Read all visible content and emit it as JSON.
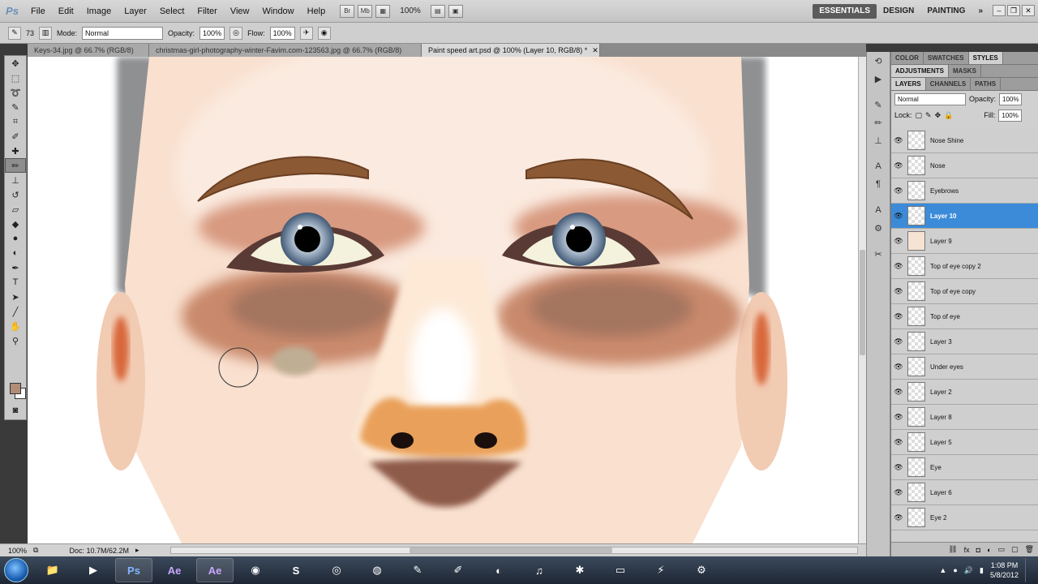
{
  "menubar": {
    "logo": "Ps",
    "items": [
      "File",
      "Edit",
      "Image",
      "Layer",
      "Select",
      "Filter",
      "View",
      "Window",
      "Help"
    ],
    "zoom": "100%",
    "bridge_btn": "Br",
    "minibridge_btn": "Mb",
    "workspaces": [
      "ESSENTIALS",
      "DESIGN",
      "PAINTING"
    ],
    "more": "»"
  },
  "options": {
    "brush_size": "73",
    "mode_label": "Mode:",
    "mode_value": "Normal",
    "opacity_label": "Opacity:",
    "opacity_value": "100%",
    "flow_label": "Flow:",
    "flow_value": "100%"
  },
  "doc_tabs": [
    {
      "label": "Keys-34.jpg @ 66.7% (RGB/8)"
    },
    {
      "label": "christmas-girl-photography-winter-Favim.com-123563.jpg @ 66.7% (RGB/8)"
    },
    {
      "label": "Paint speed art.psd @ 100% (Layer 10, RGB/8) *"
    }
  ],
  "status": {
    "zoom": "100%",
    "doc": "Doc: 10.7M/62.2M"
  },
  "panels": {
    "top_tabs": [
      "COLOR",
      "SWATCHES",
      "STYLES"
    ],
    "mid_tabs": [
      "ADJUSTMENTS",
      "MASKS"
    ],
    "layer_tabs": [
      "LAYERS",
      "CHANNELS",
      "PATHS"
    ],
    "blend_mode": "Normal",
    "opacity_label": "Opacity:",
    "opacity_value": "100%",
    "lock_label": "Lock:",
    "fill_label": "Fill:",
    "fill_value": "100%",
    "layers": [
      {
        "name": "Nose Shine"
      },
      {
        "name": "Nose"
      },
      {
        "name": "Eyebrows"
      },
      {
        "name": "Layer 10"
      },
      {
        "name": "Layer 9"
      },
      {
        "name": "Top of eye copy 2"
      },
      {
        "name": "Top of eye copy"
      },
      {
        "name": "Top of eye"
      },
      {
        "name": "Layer 3"
      },
      {
        "name": "Under eyes"
      },
      {
        "name": "Layer 2"
      },
      {
        "name": "Layer 8"
      },
      {
        "name": "Layer 5"
      },
      {
        "name": "Eye"
      },
      {
        "name": "Layer 6"
      },
      {
        "name": "Eye 2"
      }
    ]
  },
  "taskbar": {
    "apps": [
      "Ps",
      "Ae",
      "Ae"
    ],
    "time": "1:08 PM",
    "date": "5/8/2012"
  },
  "colors": {
    "foreground": "#b08d74",
    "background": "#ffffff",
    "selection": "#3b8bd9"
  }
}
